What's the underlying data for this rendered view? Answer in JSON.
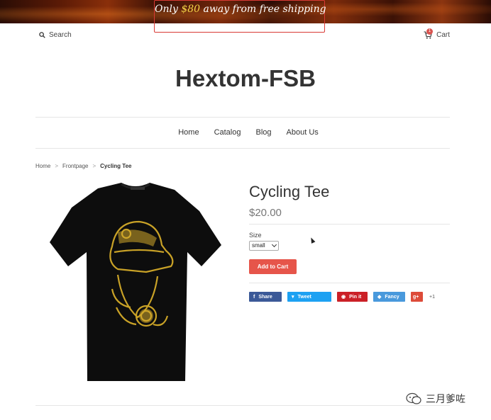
{
  "announcement": {
    "prefix": "Only ",
    "amount": "$80",
    "suffix": " away from free shipping"
  },
  "header": {
    "search_label": "Search",
    "cart_label": "Cart",
    "cart_count": "1",
    "logo": "Hextom-FSB"
  },
  "nav": {
    "items": [
      {
        "label": "Home"
      },
      {
        "label": "Catalog"
      },
      {
        "label": "Blog"
      },
      {
        "label": "About Us"
      }
    ]
  },
  "breadcrumb": {
    "home": "Home",
    "sep1": ">",
    "frontpage": "Frontpage",
    "sep2": ">",
    "current": "Cycling Tee"
  },
  "product": {
    "title": "Cycling Tee",
    "price": "$20.00",
    "size_label": "Size",
    "size_value": "small",
    "add_to_cart": "Add to Cart"
  },
  "share": {
    "facebook": "Share",
    "twitter": "Tweet",
    "pinterest": "Pin it",
    "fancy": "Fancy",
    "google": "g+",
    "google_count": "+1"
  },
  "watermark": {
    "text": "三月爹咗"
  },
  "colors": {
    "promo_amount": "#f5d547",
    "add_to_cart": "#e6554a",
    "facebook": "#3b5998",
    "twitter": "#1da1f2",
    "pinterest": "#cb2027",
    "fancy": "#4999dc",
    "google": "#dd4b39"
  }
}
